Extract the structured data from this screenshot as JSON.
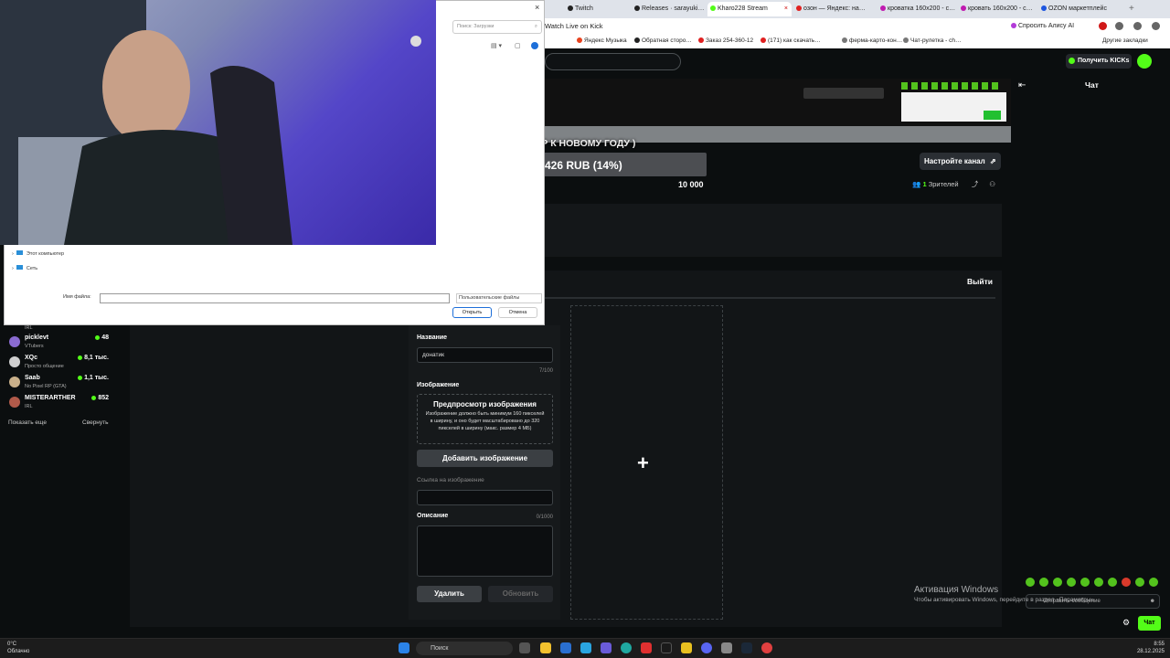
{
  "browser": {
    "tabs": [
      "Twitch",
      "Releases · sarayuki…",
      "Kharo228 Stream",
      "озон — Яндекс: на…",
      "кроватка 160x200 - с…",
      "кровать 160x200 - с…",
      "OZON маркетплейс"
    ],
    "page_title": "Watch Live on Kick",
    "alice_label": "Спросить Алису AI",
    "other_bookmarks": "Другие закладки",
    "bookmarks": [
      "Яндекс Музыка",
      "Обратная сторо…",
      "Заказ 254-360-12",
      "(171) как скачать…",
      "ферма-карто-кон…",
      "Чат-рулетка - ch…"
    ]
  },
  "kick": {
    "get_kicks": "Получить KICKs",
    "setup_channel": "Настройте канал",
    "viewers_count": "1",
    "viewers_label": "Зрителей",
    "exit": "Выйти",
    "chat_title": "Чат",
    "chat_placeholder": "Отправить сообщение",
    "chat_send": "Чат",
    "goal": {
      "title": "СБОР К НОВОМУ ГОДУ )",
      "amount_text": "1 426 RUB (14%)",
      "progress_fraction": 0.14,
      "start": "0",
      "target": "10 000"
    },
    "form": {
      "name_label": "Название",
      "name_value": "донатик",
      "name_counter": "7/100",
      "image_label": "Изображение",
      "preview_title": "Предпросмотр изображения",
      "preview_desc": "Изображение должно быть минимум 160 пикселей в ширину, и оно будет масштабировано до 320 пикселей в ширину (макс. размер 4 МБ)",
      "add_image": "Добавить изображение",
      "image_link_label": "Ссылка на изображение",
      "description_label": "Описание",
      "description_counter": "0/1000",
      "delete": "Удалить",
      "update": "Обновить"
    },
    "sidebar": {
      "top_category": "IRL",
      "channels": [
        {
          "name": "picklevt",
          "category": "VTubers",
          "viewers": "48",
          "color": "#8a6bd1"
        },
        {
          "name": "XQc",
          "category": "Просто общение",
          "viewers": "8,1 тыс.",
          "color": "#cfcfcf"
        },
        {
          "name": "Saab",
          "category": "No Pixel RP (GTA)",
          "viewers": "1,1 тыс.",
          "color": "#c9b08a"
        },
        {
          "name": "MISTERARTHER",
          "category": "IRL",
          "viewers": "852",
          "color": "#b15a4a"
        }
      ],
      "show_more": "Показать еще",
      "collapse": "Свернуть"
    }
  },
  "dialog": {
    "search_placeholder": "Поиск: Загрузки",
    "tree_this_pc": "Этот компьютер",
    "tree_network": "Сеть",
    "filename_label": "Имя файла:",
    "filetype": "Пользовательские файлы",
    "open": "Открыть",
    "cancel": "Отмена"
  },
  "windows": {
    "activation_title": "Активация Windows",
    "activation_text": "Чтобы активировать Windows, перейдите в раздел «Параметры»."
  },
  "taskbar": {
    "weather_temp": "0°C",
    "weather_text": "Облачно",
    "search_label": "Поиск",
    "time": "8:55",
    "date": "28.12.2025"
  }
}
